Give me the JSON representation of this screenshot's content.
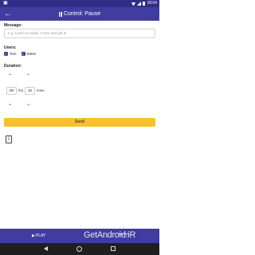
{
  "status_bar": {
    "time": "18:04"
  },
  "app_bar": {
    "title": "Control: Pause",
    "back_icon": "arrow-left-icon",
    "pause_icon": "pause-icon"
  },
  "message": {
    "label": "Message:",
    "placeholder": "e.g. Lunch is ready. Come and get it!"
  },
  "users": {
    "label": "Users:",
    "items": [
      {
        "name": "Tom",
        "checked": true
      },
      {
        "name": "Steve",
        "checked": true
      }
    ]
  },
  "duration": {
    "label": "Duration:",
    "hours": "00",
    "hours_unit": "hrs",
    "minutes": "10",
    "minutes_unit": "mins"
  },
  "send_button": {
    "label": "Send"
  },
  "action_bar": {
    "play_label": "PLAY",
    "pause_label": "PAUSE",
    "watermark": "GetAndroid.iR"
  },
  "colors": {
    "primary": "#3f3d9f",
    "status_bar": "#2f2d86",
    "accent": "#f6c12a"
  }
}
